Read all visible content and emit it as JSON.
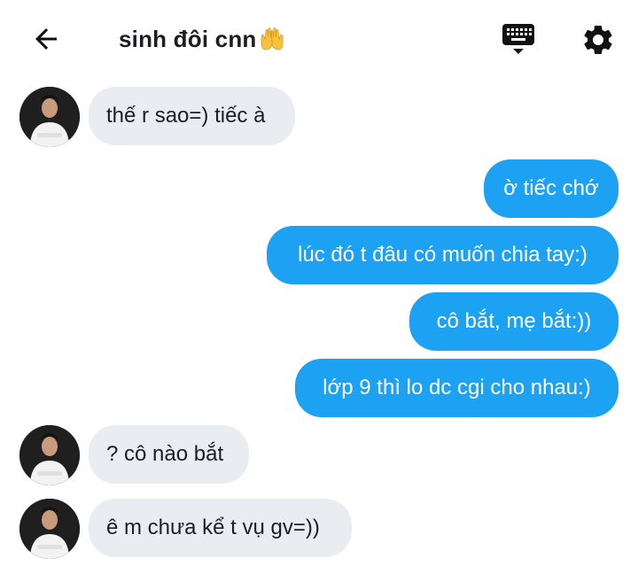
{
  "header": {
    "title": "sinh đôi cnn",
    "back_icon": "arrow-left-icon",
    "keyboard_icon": "keyboard-icon",
    "settings_icon": "gear-icon",
    "title_emoji": "palms-up-together-emoji"
  },
  "colors": {
    "outgoing_bubble": "#1da1f2",
    "incoming_bubble": "#e9edf2",
    "text": "#1c1e21"
  },
  "messages": [
    {
      "direction": "incoming",
      "text": "thế r sao=) tiếc à"
    },
    {
      "direction": "outgoing",
      "text": "ờ tiếc chớ"
    },
    {
      "direction": "outgoing",
      "text": "lúc đó t đâu có muốn chia tay:)"
    },
    {
      "direction": "outgoing",
      "text": "cô bắt, mẹ bắt:))"
    },
    {
      "direction": "outgoing",
      "text": "lớp 9 thì lo dc cgi cho nhau:)"
    },
    {
      "direction": "incoming",
      "text": "? cô nào bắt"
    },
    {
      "direction": "incoming",
      "text": "ê m chưa kể t vụ gv=))"
    }
  ]
}
